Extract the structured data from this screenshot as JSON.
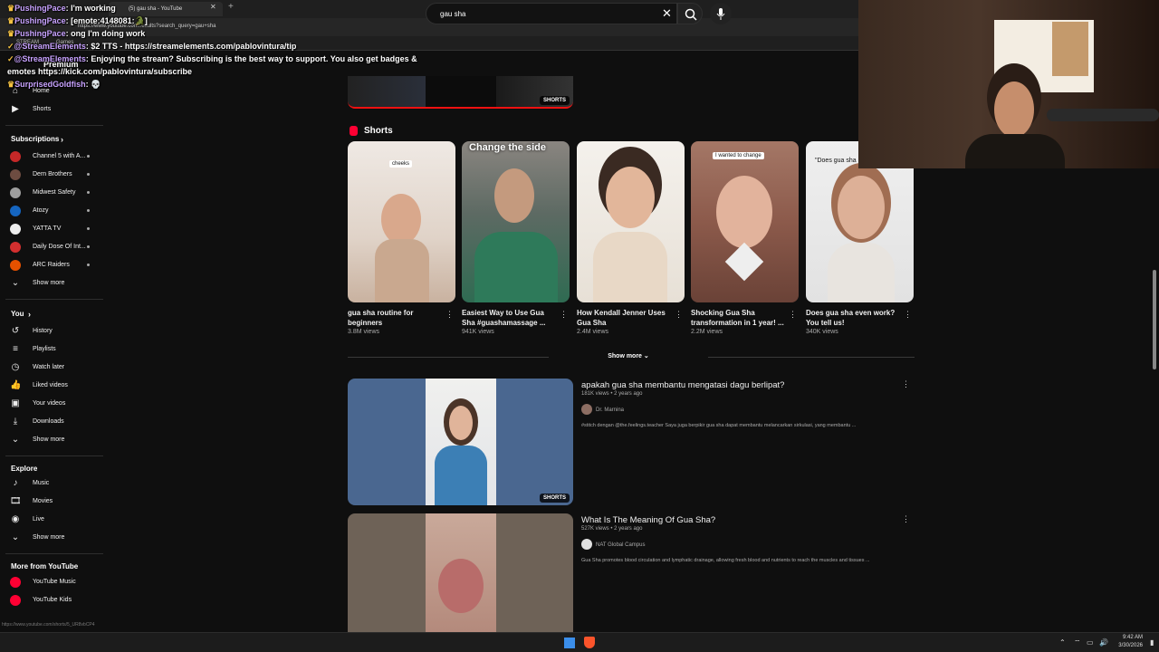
{
  "browser": {
    "tab_title": "(5) gau sha - YouTube",
    "url": "https://www.youtube.com/results?search_query=gau+sha",
    "bookmarks": [
      "STREAM",
      "Games"
    ]
  },
  "header": {
    "premium_label": "Premium",
    "search_value": "gau sha"
  },
  "sidebar": {
    "main": [
      {
        "label": "Home",
        "icon": "home-icon"
      },
      {
        "label": "Shorts",
        "icon": "shorts-icon"
      }
    ],
    "subscriptions_title": "Subscriptions",
    "subscriptions": [
      {
        "label": "Channel 5 with A...",
        "color": "#c62828"
      },
      {
        "label": "Dern Brothers",
        "color": "#6d4c41"
      },
      {
        "label": "Midwest Safety",
        "color": "#9e9e9e"
      },
      {
        "label": "Atozy",
        "color": "#1565c0"
      },
      {
        "label": "YATTA TV",
        "color": "#ffffff"
      },
      {
        "label": "Daily Dose Of Int...",
        "color": "#d32f2f"
      },
      {
        "label": "ARC Raiders",
        "color": "#e65100"
      }
    ],
    "show_more": "Show more",
    "you_title": "You",
    "you_items": [
      {
        "label": "History",
        "icon": "history-icon"
      },
      {
        "label": "Playlists",
        "icon": "playlists-icon"
      },
      {
        "label": "Watch later",
        "icon": "watch-later-icon"
      },
      {
        "label": "Liked videos",
        "icon": "like-icon"
      },
      {
        "label": "Your videos",
        "icon": "your-videos-icon"
      },
      {
        "label": "Downloads",
        "icon": "download-icon"
      }
    ],
    "explore_title": "Explore",
    "explore_items": [
      {
        "label": "Music",
        "icon": "music-icon"
      },
      {
        "label": "Movies",
        "icon": "movies-icon"
      },
      {
        "label": "Live",
        "icon": "live-icon"
      }
    ],
    "more_title": "More from YouTube",
    "more_items": [
      {
        "label": "YouTube Music",
        "color": "#ff0033"
      },
      {
        "label": "YouTube Kids",
        "color": "#ff0033"
      }
    ],
    "status_url": "https://www.youtube.com/shorts/5_UR8vbCP4"
  },
  "main": {
    "shorts_badge": "SHORTS",
    "shorts_section_title": "Shorts",
    "shorts": [
      {
        "title": "gua sha routine for beginners",
        "views": "3.8M views",
        "overlay": "cheeks"
      },
      {
        "title": "Easiest Way to Use Gua Sha #guashamassage ...",
        "views": "941K views",
        "overlay": "Change the side"
      },
      {
        "title": "How Kendall Jenner Uses Gua Sha",
        "views": "2.4M views",
        "overlay": ""
      },
      {
        "title": "Shocking Gua Sha transformation in 1 year! ...",
        "views": "2.2M views",
        "overlay": "I wanted to change"
      },
      {
        "title": "Does gua sha even work? You tell us!",
        "views": "340K views",
        "overlay": "\"Does gua sha"
      }
    ],
    "show_more": "Show more",
    "videos": [
      {
        "title": "apakah gua sha membantu mengatasi dagu berlipat?",
        "meta": "181K views • 2 years ago",
        "channel": "Dr. Marnina",
        "desc": "#stitch dengan @the.feelings.teacher Saya juga berpikir gua sha dapat membantu melancarkan sirkulasi, yang membantu ..."
      },
      {
        "title": "What Is The Meaning Of Gua Sha?",
        "meta": "527K views • 2 years ago",
        "channel": "NAT Global Campus",
        "desc": "Gua Sha promotes blood circulation and lymphatic drainage, allowing fresh blood and nutrients to reach the muscles and tissues ..."
      }
    ]
  },
  "chat": [
    {
      "user": "PushingPace",
      "msg": ": I'm working"
    },
    {
      "user": "PushingPace",
      "msg": ": [emote:4148081:🐊]"
    },
    {
      "user": "PushingPace",
      "msg": ": ong I'm doing work"
    },
    {
      "user": "@StreamElements",
      "msg": ": $2 TTS - https://streamelements.com/pablovintura/tip"
    },
    {
      "user": "@StreamElements",
      "msg": ": Enjoying the stream? Subscribing is the best way to support. You also get badges &"
    },
    {
      "user": "",
      "msg": "emotes https://kick.com/pablovintura/subscribe"
    },
    {
      "user": "SurprisedGoldfish",
      "msg": ": 💀"
    }
  ],
  "taskbar": {
    "time": "9:42 AM",
    "date": "3/30/2026"
  }
}
